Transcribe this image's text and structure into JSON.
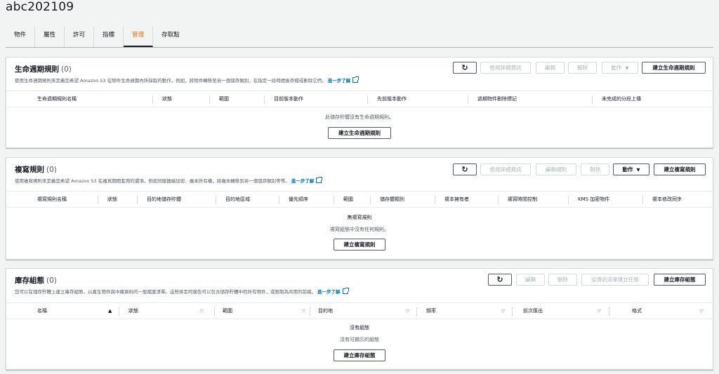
{
  "page": {
    "title": "abc202109"
  },
  "tabs": [
    "物件",
    "屬性",
    "許可",
    "指標",
    "管理",
    "存取點"
  ],
  "active_tab_index": 4,
  "lifecycle": {
    "title": "生命週期規則",
    "count": "(0)",
    "desc": "使用生命週期規則來定義您希望 Amazon S3 在物件生命週期內所採取的動作，例如，將物件轉移至另一個儲存類別，在指定一段時間後存檔或刪除它們。",
    "learn_more": "進一步了解",
    "buttons": {
      "view": "檢視詳細資訊",
      "edit": "編輯",
      "delete": "刪除",
      "actions": "動作",
      "create": "建立生命週期規則"
    },
    "columns": [
      "生命週期規則名稱",
      "狀態",
      "範圍",
      "目前版本動作",
      "先前版本動作",
      "過期物件刪除標記",
      "未完成的分段上傳"
    ],
    "empty": "此儲存貯體沒有生命週期規則。",
    "empty_button": "建立生命週期規則"
  },
  "replication": {
    "title": "複寫規則",
    "count": "(0)",
    "desc": "使用複寫規則來定義您希望 Amazon S3 在複寫期間套用的選項，例如伺服器端加密、複本所有權，將複本轉移到另一個儲存類別等等。",
    "learn_more": "進一步了解",
    "buttons": {
      "view": "檢視詳細資訊",
      "edit": "編輯規則",
      "delete": "刪除",
      "actions": "動作",
      "create": "建立複寫規則"
    },
    "columns": [
      "複寫規則名稱",
      "狀態",
      "目的地儲存貯體",
      "目的地區域",
      "優先順序",
      "範圍",
      "儲存體類別",
      "複本擁有者",
      "複寫時間控制",
      "KMS 加密物件",
      "複本修改同步"
    ],
    "empty_title": "無複寫規則",
    "empty": "複寫組態中沒有任何規則。",
    "empty_button": "建立複寫規則"
  },
  "inventory": {
    "title": "庫存組態",
    "count": "(0)",
    "desc": "您可以在儲存貯體上建立庫存組態，以產生物件與中繼資料的一般檔案清單。這些排定的報告可以包含儲存貯體中的所有物件，或限制為共用的前綴。",
    "learn_more": "進一步了解",
    "buttons": {
      "edit": "編輯",
      "delete": "刪除",
      "create_job": "從資訊清單建立任務",
      "create": "建立庫存組態"
    },
    "columns": [
      "名稱",
      "狀態",
      "範圍",
      "目的地",
      "頻率",
      "前次匯出",
      "格式"
    ],
    "empty_title": "沒有組態",
    "empty": "沒有可顯示的組態",
    "empty_button": "建立庫存組態"
  },
  "icons": {
    "refresh": "refresh-icon",
    "external": "external-link-icon",
    "caret": "caret-down-icon",
    "sort": "sort-icon"
  },
  "colors": {
    "active_tab": "#ec7211",
    "link": "#0073bb"
  }
}
